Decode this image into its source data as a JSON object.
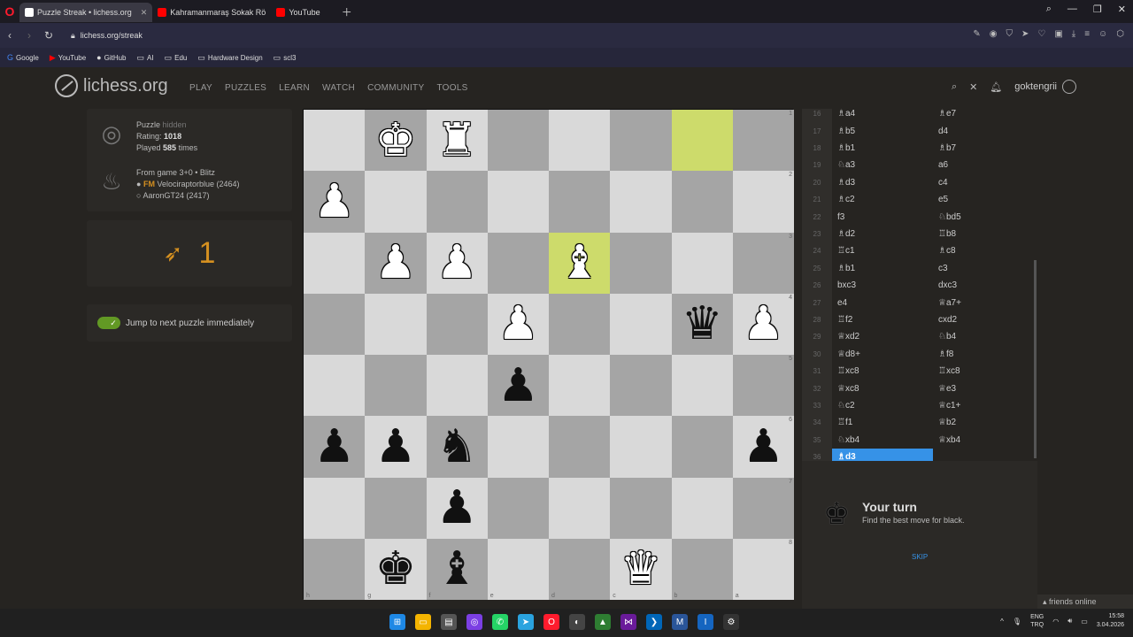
{
  "browser": {
    "tabs": [
      {
        "label": "Puzzle Streak • lichess.org",
        "active": true,
        "favicon_color": "#ffffff"
      },
      {
        "label": "Kahramanmaraş Sokak Rö",
        "active": false,
        "favicon_color": "#ff0000"
      },
      {
        "label": "YouTube",
        "active": false,
        "favicon_color": "#ff0000"
      }
    ],
    "url": "lichess.org/streak",
    "bookmarks": [
      {
        "label": "Google",
        "icon": "google-icon"
      },
      {
        "label": "YouTube",
        "icon": "youtube-icon"
      },
      {
        "label": "GitHub",
        "icon": "github-icon"
      },
      {
        "label": "AI",
        "icon": "folder-icon"
      },
      {
        "label": "Edu",
        "icon": "folder-icon"
      },
      {
        "label": "Hardware Design",
        "icon": "folder-icon"
      },
      {
        "label": "scl3",
        "icon": "folder-icon"
      }
    ]
  },
  "header": {
    "site_name": "lichess.org",
    "nav": [
      "PLAY",
      "PUZZLES",
      "LEARN",
      "WATCH",
      "COMMUNITY",
      "TOOLS"
    ],
    "username": "goktengrii"
  },
  "puzzle": {
    "label": "Puzzle",
    "hidden": "hidden",
    "rating_label": "Rating:",
    "rating": "1018",
    "played_prefix": "Played",
    "played": "585",
    "played_suffix": "times",
    "from_game": "From game 3+0 • Blitz",
    "player1_title": "FM",
    "player1": "Velociraptorblue",
    "player1_rating": "(2464)",
    "player2": "AaronGT24",
    "player2_rating": "(2417)"
  },
  "streak": {
    "value": "1"
  },
  "toggle_label": "Jump to next puzzle immediately",
  "board": {
    "ranks": [
      "1",
      "2",
      "3",
      "4",
      "5",
      "6",
      "7",
      "8"
    ],
    "files": [
      "h",
      "g",
      "f",
      "e",
      "d",
      "c",
      "b",
      "a"
    ],
    "rows": [
      [
        [
          "",
          ""
        ],
        [
          "w",
          "♚"
        ],
        [
          "w",
          "♜"
        ],
        [
          "",
          ""
        ],
        [
          "",
          ""
        ],
        [
          "",
          ""
        ],
        [
          "",
          ""
        ],
        [
          "",
          ""
        ]
      ],
      [
        [
          "w",
          "♟"
        ],
        [
          "",
          ""
        ],
        [
          "",
          ""
        ],
        [
          "",
          ""
        ],
        [
          "",
          ""
        ],
        [
          "",
          ""
        ],
        [
          "",
          ""
        ],
        [
          "",
          ""
        ]
      ],
      [
        [
          "",
          ""
        ],
        [
          "w",
          "♟"
        ],
        [
          "w",
          "♟"
        ],
        [
          "",
          ""
        ],
        [
          "w",
          "♝"
        ],
        [
          "",
          ""
        ],
        [
          "",
          ""
        ],
        [
          "",
          ""
        ]
      ],
      [
        [
          "",
          ""
        ],
        [
          "",
          ""
        ],
        [
          "",
          ""
        ],
        [
          "w",
          "♟"
        ],
        [
          "",
          ""
        ],
        [
          "",
          ""
        ],
        [
          "b",
          "♛"
        ],
        [
          "w",
          "♟"
        ]
      ],
      [
        [
          "",
          ""
        ],
        [
          "",
          ""
        ],
        [
          "",
          ""
        ],
        [
          "b",
          "♟"
        ],
        [
          "",
          ""
        ],
        [
          "",
          ""
        ],
        [
          "",
          ""
        ],
        [
          "",
          ""
        ]
      ],
      [
        [
          "b",
          "♟"
        ],
        [
          "b",
          "♟"
        ],
        [
          "b",
          "♞"
        ],
        [
          "",
          ""
        ],
        [
          "",
          ""
        ],
        [
          "",
          ""
        ],
        [
          "",
          ""
        ],
        [
          "b",
          "♟"
        ]
      ],
      [
        [
          "",
          ""
        ],
        [
          "",
          ""
        ],
        [
          "b",
          "♟"
        ],
        [
          "",
          ""
        ],
        [
          "",
          ""
        ],
        [
          "",
          ""
        ],
        [
          "",
          ""
        ],
        [
          "",
          ""
        ]
      ],
      [
        [
          "",
          ""
        ],
        [
          "b",
          "♚"
        ],
        [
          "b",
          "♝"
        ],
        [
          "",
          ""
        ],
        [
          "",
          ""
        ],
        [
          "w",
          "♛"
        ],
        [
          "",
          ""
        ],
        [
          "",
          ""
        ]
      ]
    ],
    "highlights": [
      [
        0,
        6
      ],
      [
        2,
        4
      ]
    ]
  },
  "moves": [
    {
      "no": "16",
      "w": "♗a4",
      "b": "♗e7"
    },
    {
      "no": "17",
      "w": "♗b5",
      "b": "d4"
    },
    {
      "no": "18",
      "w": "♗b1",
      "b": "♗b7"
    },
    {
      "no": "19",
      "w": "♘a3",
      "b": "a6"
    },
    {
      "no": "20",
      "w": "♗d3",
      "b": "c4"
    },
    {
      "no": "21",
      "w": "♗c2",
      "b": "e5"
    },
    {
      "no": "22",
      "w": "f3",
      "b": "♘bd5"
    },
    {
      "no": "23",
      "w": "♗d2",
      "b": "♖b8"
    },
    {
      "no": "24",
      "w": "♖c1",
      "b": "♗c8"
    },
    {
      "no": "25",
      "w": "♗b1",
      "b": "c3"
    },
    {
      "no": "26",
      "w": "bxc3",
      "b": "dxc3"
    },
    {
      "no": "27",
      "w": "e4",
      "b": "♕a7+"
    },
    {
      "no": "28",
      "w": "♖f2",
      "b": "cxd2"
    },
    {
      "no": "29",
      "w": "♕xd2",
      "b": "♘b4"
    },
    {
      "no": "30",
      "w": "♕d8+",
      "b": "♗f8"
    },
    {
      "no": "31",
      "w": "♖xc8",
      "b": "♖xc8"
    },
    {
      "no": "32",
      "w": "♕xc8",
      "b": "♕e3"
    },
    {
      "no": "33",
      "w": "♘c2",
      "b": "♕c1+"
    },
    {
      "no": "34",
      "w": "♖f1",
      "b": "♕b2"
    },
    {
      "no": "35",
      "w": "♘xb4",
      "b": "♕xb4"
    },
    {
      "no": "36",
      "w": "♗d3",
      "b": ""
    }
  ],
  "turn": {
    "title": "Your turn",
    "subtitle": "Find the best move for black.",
    "skip": "SKIP"
  },
  "friends": "friends online",
  "taskbar": {
    "lang1": "ENG",
    "lang2": "TRQ",
    "time": "15:58",
    "date": "3.04.2026"
  }
}
